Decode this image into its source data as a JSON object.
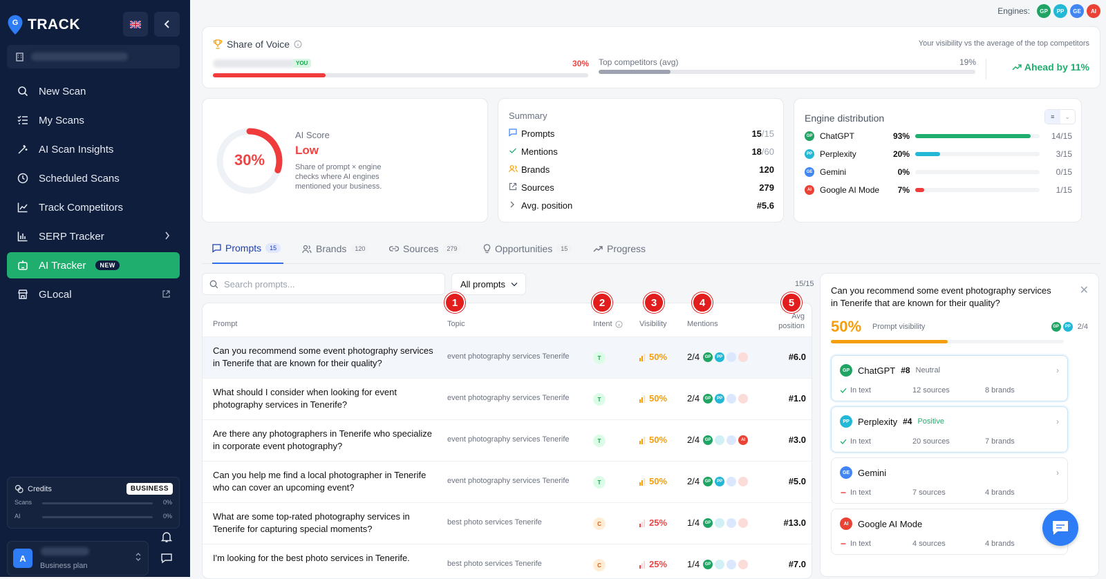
{
  "app": {
    "logo_text": "TRACK"
  },
  "sidebar": {
    "items": [
      {
        "label": "New Scan",
        "icon": "search-icon"
      },
      {
        "label": "My Scans",
        "icon": "list-check-icon"
      },
      {
        "label": "AI Scan Insights",
        "icon": "wand-icon"
      },
      {
        "label": "Scheduled Scans",
        "icon": "clock-icon"
      },
      {
        "label": "Track Competitors",
        "icon": "line-chart-icon"
      },
      {
        "label": "SERP Tracker",
        "icon": "bar-chart-icon"
      },
      {
        "label": "AI Tracker",
        "icon": "robot-icon",
        "badge": "NEW"
      },
      {
        "label": "GLocal",
        "icon": "store-icon"
      }
    ],
    "credits": {
      "title": "Credits",
      "plan_badge": "BUSINESS",
      "scans_label": "Scans",
      "scans_pct": "0%",
      "ai_label": "AI",
      "ai_pct": "0%"
    },
    "user": {
      "avatar_letter": "A",
      "plan": "Business plan"
    }
  },
  "engines": {
    "label": "Engines:",
    "list": [
      {
        "code": "GP",
        "color": "#1fa463"
      },
      {
        "code": "PP",
        "color": "#22b8d6"
      },
      {
        "code": "GE",
        "color": "#4285f4"
      },
      {
        "code": "AI",
        "color": "#ea4335"
      }
    ]
  },
  "sov": {
    "title": "Share of Voice",
    "you_badge": "YOU",
    "you_pct": "30%",
    "you_value": 0.3,
    "competitors_label": "Top competitors (avg)",
    "competitors_pct": "19%",
    "competitors_value": 0.19,
    "vs_label": "Your visibility vs the average of the top competitors",
    "ahead": "Ahead by 11%"
  },
  "ai_score": {
    "pct": "30%",
    "value": 0.3,
    "label": "AI Score",
    "level": "Low",
    "desc": "Share of prompt × engine checks where AI engines mentioned your business."
  },
  "summary": {
    "title": "Summary",
    "rows": [
      {
        "label": "Prompts",
        "value": "15",
        "total": "/15"
      },
      {
        "label": "Mentions",
        "value": "18",
        "total": "/60"
      },
      {
        "label": "Brands",
        "value": "120",
        "total": ""
      },
      {
        "label": "Sources",
        "value": "279",
        "total": ""
      },
      {
        "label": "Avg. position",
        "value": "#5.6",
        "total": ""
      }
    ]
  },
  "engine_distribution": {
    "title": "Engine distribution",
    "rows": [
      {
        "code": "GP",
        "name": "ChatGPT",
        "pct": "93%",
        "value": 0.93,
        "count": "14/15",
        "color": "#1fa463",
        "bar": "#1fae6e"
      },
      {
        "code": "PP",
        "name": "Perplexity",
        "pct": "20%",
        "value": 0.2,
        "count": "3/15",
        "color": "#22b8d6",
        "bar": "#22b8d6"
      },
      {
        "code": "GE",
        "name": "Gemini",
        "pct": "0%",
        "value": 0.0,
        "count": "0/15",
        "color": "#4285f4",
        "bar": "#4285f4"
      },
      {
        "code": "AI",
        "name": "Google AI Mode",
        "pct": "7%",
        "value": 0.07,
        "count": "1/15",
        "color": "#ea4335",
        "bar": "#ef3b3b"
      }
    ]
  },
  "tabs": [
    {
      "label": "Prompts",
      "count": "15"
    },
    {
      "label": "Brands",
      "count": "120"
    },
    {
      "label": "Sources",
      "count": "279"
    },
    {
      "label": "Opportunities",
      "count": "15"
    },
    {
      "label": "Progress",
      "count": ""
    }
  ],
  "search": {
    "placeholder": "Search prompts..."
  },
  "filter": {
    "value": "All prompts"
  },
  "list_count": "15/15",
  "table": {
    "headers": {
      "prompt": "Prompt",
      "topic": "Topic",
      "intent": "Intent",
      "visibility": "Visibility",
      "mentions": "Mentions",
      "avg_position": "Avg position"
    },
    "markers": [
      "1",
      "2",
      "3",
      "4",
      "5"
    ],
    "rows": [
      {
        "prompt": "Can you recommend some event photography services in Tenerife that are known for their quality?",
        "topic": "event photography services Tenerife",
        "intent": "T",
        "visibility": "50%",
        "mentions": "2/4",
        "engines": [
          1,
          1,
          0,
          0
        ],
        "avg": "#6.0"
      },
      {
        "prompt": "What should I consider when looking for event photography services in Tenerife?",
        "topic": "event photography services Tenerife",
        "intent": "T",
        "visibility": "50%",
        "mentions": "2/4",
        "engines": [
          1,
          1,
          0,
          0
        ],
        "avg": "#1.0"
      },
      {
        "prompt": "Are there any photographers in Tenerife who specialize in corporate event photography?",
        "topic": "event photography services Tenerife",
        "intent": "T",
        "visibility": "50%",
        "mentions": "2/4",
        "engines": [
          1,
          0,
          0,
          1
        ],
        "avg": "#3.0"
      },
      {
        "prompt": "Can you help me find a local photographer in Tenerife who can cover an upcoming event?",
        "topic": "event photography services Tenerife",
        "intent": "T",
        "visibility": "50%",
        "mentions": "2/4",
        "engines": [
          1,
          1,
          0,
          0
        ],
        "avg": "#5.0"
      },
      {
        "prompt": "What are some top-rated photography services in Tenerife for capturing special moments?",
        "topic": "best photo services Tenerife",
        "intent": "C",
        "visibility": "25%",
        "mentions": "1/4",
        "engines": [
          1,
          0,
          0,
          0
        ],
        "avg": "#13.0"
      },
      {
        "prompt": "I'm looking for the best photo services in Tenerife.",
        "topic": "best photo services Tenerife",
        "intent": "C",
        "visibility": "25%",
        "mentions": "1/4",
        "engines": [
          1,
          0,
          0,
          0
        ],
        "avg": "#7.0"
      }
    ]
  },
  "detail": {
    "question": "Can you recommend some event photography services in Tenerife that are known for their quality?",
    "visibility_pct": "50%",
    "visibility_value": 0.5,
    "visibility_label": "Prompt visibility",
    "count": "2/4",
    "engines": [
      {
        "code": "GP",
        "name": "ChatGPT",
        "rank": "#8",
        "sentiment": "Neutral",
        "status": "In text",
        "sources": "12 sources",
        "brands": "8 brands",
        "color": "#1fa463",
        "found": true
      },
      {
        "code": "PP",
        "name": "Perplexity",
        "rank": "#4",
        "sentiment": "Positive",
        "status": "In text",
        "sources": "20 sources",
        "brands": "7 brands",
        "color": "#22b8d6",
        "found": true
      },
      {
        "code": "GE",
        "name": "Gemini",
        "rank": "",
        "sentiment": "",
        "status": "In text",
        "sources": "7 sources",
        "brands": "4 brands",
        "color": "#4285f4",
        "found": false
      },
      {
        "code": "AI",
        "name": "Google AI Mode",
        "rank": "",
        "sentiment": "",
        "status": "In text",
        "sources": "4 sources",
        "brands": "4 brands",
        "color": "#ea4335",
        "found": false
      }
    ]
  }
}
